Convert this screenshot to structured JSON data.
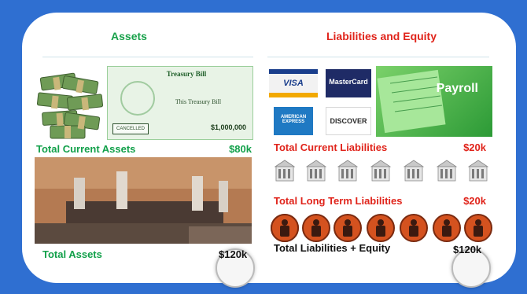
{
  "assets": {
    "title": "Assets",
    "total_current_label": "Total Current Assets",
    "total_current_value": "$80k",
    "total_label": "Total Assets",
    "total_value": "$120k",
    "treasury_bill": {
      "header": "Treasury Bill",
      "line": "This Treasury Bill",
      "amount": "$1,000,000",
      "stamp": "CANCELLED"
    }
  },
  "liabilities": {
    "title": "Liabilities and Equity",
    "current_label": "Total Current Liabilities",
    "current_value": "$20k",
    "long_term_label": "Total Long Term Liabilities",
    "long_term_value": "$20k",
    "total_label": "Total Liabilities + Equity",
    "total_value": "$120k",
    "cards": [
      "VISA",
      "MasterCard",
      "AMERICAN EXPRESS",
      "DISCOVER"
    ],
    "payroll_label": "Payroll"
  },
  "colors": {
    "background": "#2f6fd1",
    "assets_green": "#12a04a",
    "liabilities_red": "#e0241b"
  }
}
